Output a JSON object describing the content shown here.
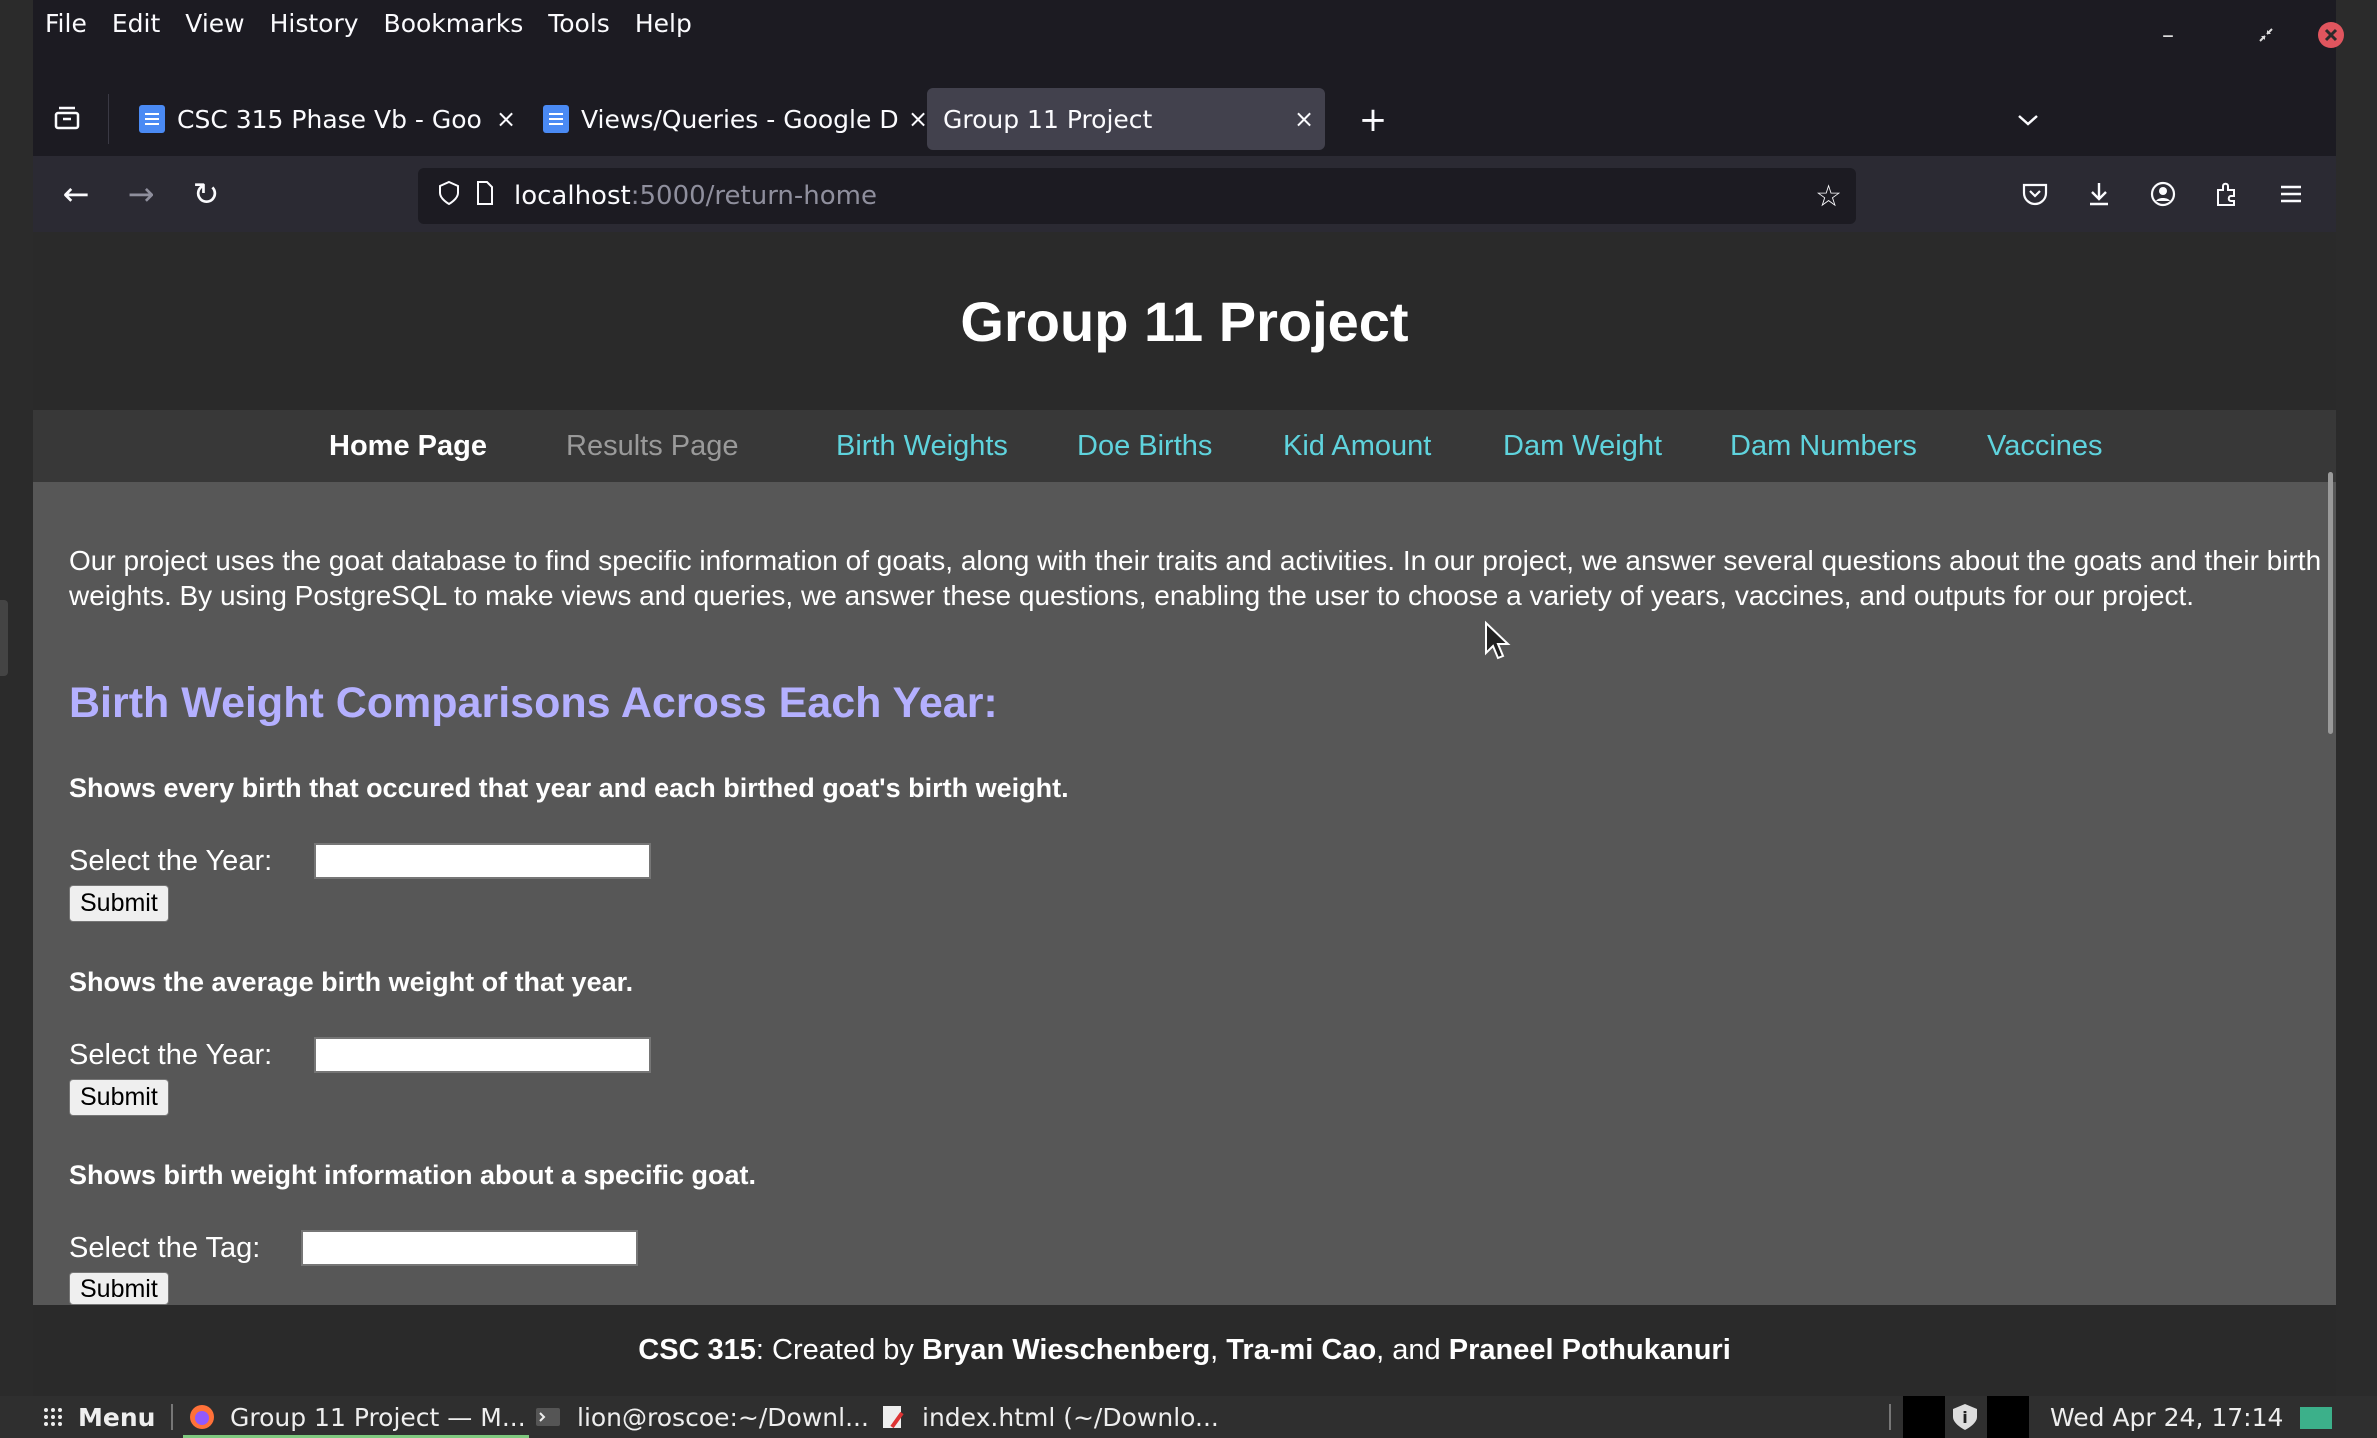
{
  "menubar": {
    "items": [
      "File",
      "Edit",
      "View",
      "History",
      "Bookmarks",
      "Tools",
      "Help"
    ]
  },
  "tabs": [
    {
      "label": "CSC 315 Phase Vb - Goo",
      "close": "×"
    },
    {
      "label": "Views/Queries - Google D",
      "close": "×"
    },
    {
      "label": "Group 11 Project",
      "close": "×"
    }
  ],
  "toolbar": {
    "new_tab": "+",
    "all_tabs": "⌄",
    "back": "←",
    "forward": "→",
    "reload": "↻"
  },
  "url": {
    "host": "localhost",
    "path": ":5000/return-home"
  },
  "page": {
    "title": "Group 11 Project",
    "nav": {
      "home": "Home Page",
      "results": "Results Page",
      "birth_weights": "Birth Weights",
      "doe_births": "Doe Births",
      "kid_amount": "Kid Amount",
      "dam_weight": "Dam Weight",
      "dam_numbers": "Dam Numbers",
      "vaccines": "Vaccines"
    },
    "intro": "Our project uses the goat database to find specific information of goats, along with their traits and activities. In our project, we answer several questions about the goats and their birth weights. By using PostgreSQL to make views and queries, we answer these questions, enabling the user to choose a variety of years, vaccines, and outputs for our project.",
    "section_title": "Birth Weight Comparisons Across Each Year:",
    "queries": [
      {
        "description": "Shows every birth that occured that year and each birthed goat's birth weight.",
        "label": "Select the Year:",
        "submit": "Submit"
      },
      {
        "description": "Shows the average birth weight of that year.",
        "label": "Select the Year:",
        "submit": "Submit"
      },
      {
        "description": "Shows birth weight information about a specific goat.",
        "label": "Select the Tag:",
        "submit": "Submit"
      }
    ]
  },
  "footer": {
    "course": "CSC 315",
    "created_by": ": Created by ",
    "author1": "Bryan Wieschenberg",
    "comma": ", ",
    "author2": "Tra-mi Cao",
    "and": ", and ",
    "author3": "Praneel Pothukanuri"
  },
  "taskbar": {
    "menu": "Menu",
    "items": [
      "Group 11 Project — M...",
      "lion@roscoe:~/Downl...",
      "index.html (~/Downlo..."
    ],
    "clock": "Wed Apr 24, 17:14"
  },
  "colors": {
    "nav_link": "#5fd3dd",
    "section_title": "#b4b0ff",
    "content_bg": "#575757",
    "header_bg": "#2a2a2a"
  }
}
